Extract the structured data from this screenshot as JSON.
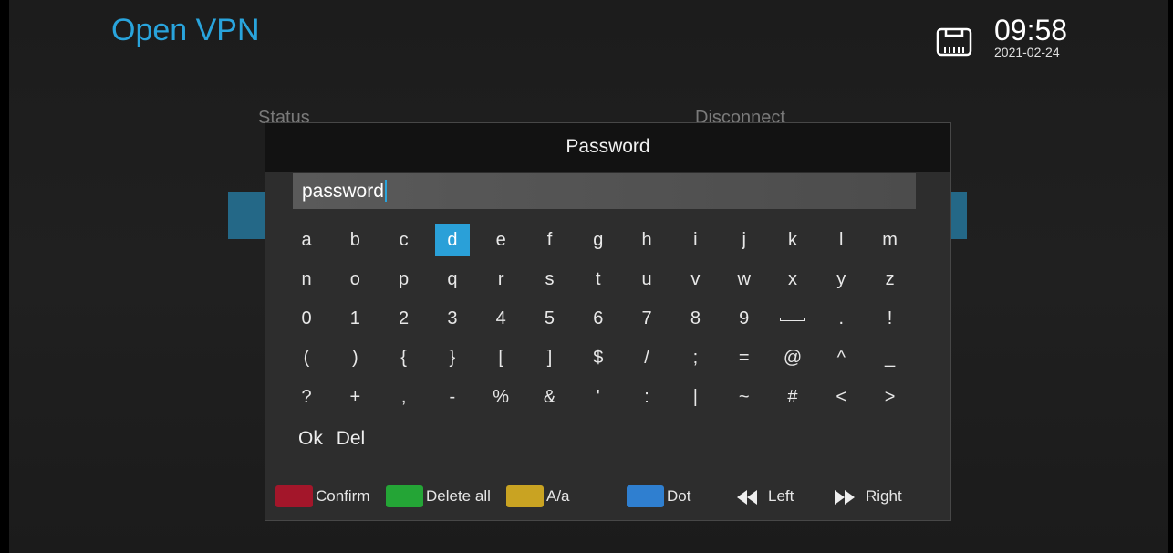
{
  "app": {
    "title": "Open VPN"
  },
  "status_bar": {
    "network_icon": "ethernet-icon",
    "time": "09:58",
    "date": "2021-02-24"
  },
  "background": {
    "status_label": "Status",
    "disconnect_label": "Disconnect"
  },
  "dialog": {
    "title": "Password",
    "input_value": "password",
    "selected_key": "d",
    "rows": [
      [
        "a",
        "b",
        "c",
        "d",
        "e",
        "f",
        "g",
        "h",
        "i",
        "j",
        "k",
        "l",
        "m"
      ],
      [
        "n",
        "o",
        "p",
        "q",
        "r",
        "s",
        "t",
        "u",
        "v",
        "w",
        "x",
        "y",
        "z"
      ],
      [
        "0",
        "1",
        "2",
        "3",
        "4",
        "5",
        "6",
        "7",
        "8",
        "9",
        "space",
        ".",
        "!"
      ],
      [
        "(",
        ")",
        "{",
        "}",
        "[",
        "]",
        "$",
        "/",
        ";",
        "=",
        "@",
        "^",
        "_"
      ],
      [
        "?",
        "+",
        ",",
        "-",
        "%",
        "&",
        "'",
        ":",
        "|",
        "~",
        "#",
        "<",
        ">"
      ]
    ],
    "ok_label": "Ok",
    "del_label": "Del"
  },
  "footer": {
    "confirm": {
      "label": "Confirm",
      "color": "#a3162a"
    },
    "delete_all": {
      "label": "Delete all",
      "color": "#24a536"
    },
    "case_toggle": {
      "label": "A/a",
      "color": "#c9a322"
    },
    "dot": {
      "label": "Dot",
      "color": "#2f7fd0"
    },
    "left": {
      "label": "Left",
      "icon": "rewind-icon"
    },
    "right": {
      "label": "Right",
      "icon": "fast-forward-icon"
    }
  }
}
